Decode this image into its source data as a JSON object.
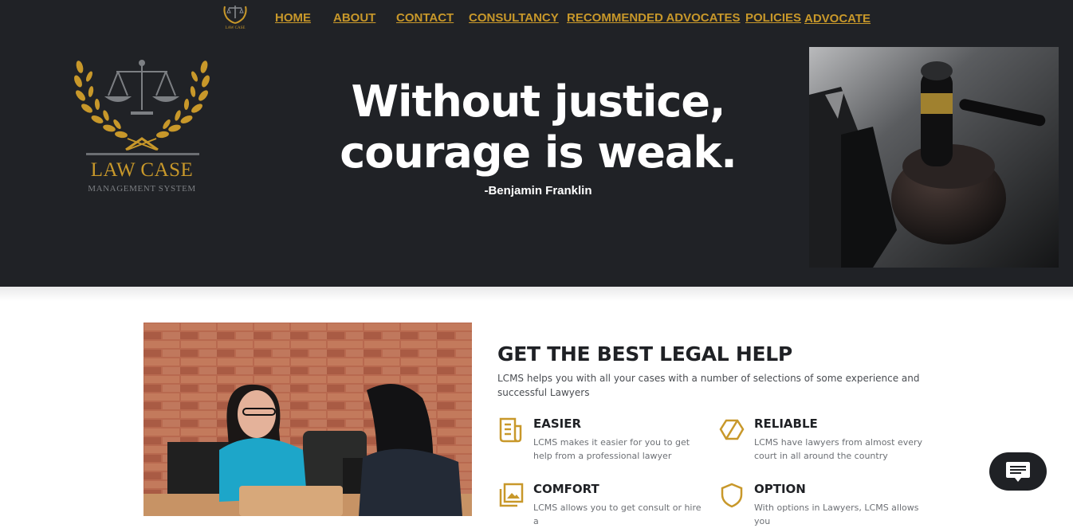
{
  "nav": {
    "logo_text": "LAW CASE",
    "items": [
      {
        "label": "HOME"
      },
      {
        "label": "ABOUT"
      },
      {
        "label": "CONTACT"
      },
      {
        "label": "CONSULTANCY"
      },
      {
        "label": "RECOMMENDED ADVOCATES"
      },
      {
        "label": "POLICIES"
      },
      {
        "label": "ADVOCATE"
      }
    ]
  },
  "hero": {
    "logo_title": "LAW CASE",
    "logo_subtitle": "MANAGEMENT SYSTEM",
    "quote": "Without justice, courage is weak.",
    "author": "-Benjamin Franklin"
  },
  "help": {
    "title": "GET THE BEST LEGAL HELP",
    "description": "LCMS helps you with all your cases with a number of selections of some experience and successful Lawyers",
    "features": [
      {
        "title": "EASIER",
        "text": "LCMS makes it easier for you to get help from a professional lawyer",
        "icon": "document-icon"
      },
      {
        "title": "RELIABLE",
        "text": "LCMS have lawyers from almost every court in all around the country",
        "icon": "cube-icon"
      },
      {
        "title": "COMFORT",
        "text": "LCMS allows you to get consult or hire a",
        "icon": "image-gallery-icon"
      },
      {
        "title": "OPTION",
        "text": "With options in Lawyers, LCMS allows you",
        "icon": "shield-icon"
      }
    ]
  },
  "colors": {
    "gold": "#c8982a",
    "dark": "#202226"
  }
}
